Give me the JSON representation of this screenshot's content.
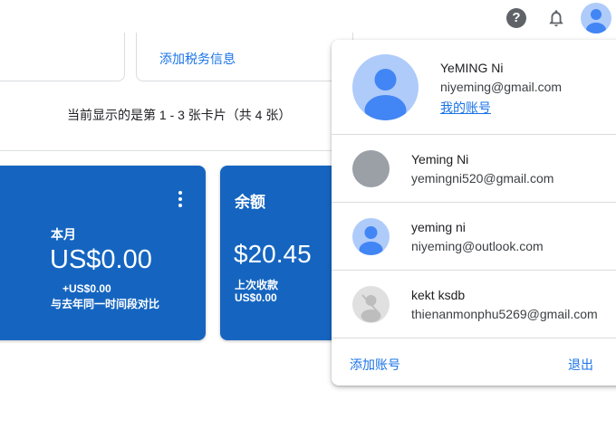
{
  "topbar": {
    "help_glyph": "?",
    "icons": [
      "help-icon",
      "bell-icon",
      "account-avatar"
    ]
  },
  "tax_card": {
    "link_label": "添加税务信息"
  },
  "showing": {
    "text": "当前显示的是第 1 - 3 张卡片（共 4 张）"
  },
  "month_card": {
    "label": "本月",
    "amount": "US$0.00",
    "delta": "+US$0.00",
    "compare": "与去年同一时间段对比",
    "color": "#1565c0"
  },
  "balance_card": {
    "title": "余额",
    "amount": "$20.45",
    "last_label": "上次收款",
    "last_value": "US$0.00",
    "color": "#1565c0"
  },
  "popup": {
    "primary": {
      "name": "YeMING Ni",
      "email": "niyeming@gmail.com",
      "my_account": "我的账号"
    },
    "accounts": [
      {
        "name": "Yeming Ni",
        "email": "yemingni520@gmail.com",
        "avatar": "gray-circle"
      },
      {
        "name": "yeming ni",
        "email": "niyeming@outlook.com",
        "avatar": "person-icon"
      },
      {
        "name": "kekt ksdb",
        "email": "thienanmonphu5269@gmail.com",
        "avatar": "no-photo-icon"
      }
    ],
    "add_account": "添加账号",
    "sign_out": "退出"
  },
  "colors": {
    "accent": "#1a73e8",
    "avatar_bg": "#aecbfa",
    "avatar_fg": "#4285f4"
  }
}
